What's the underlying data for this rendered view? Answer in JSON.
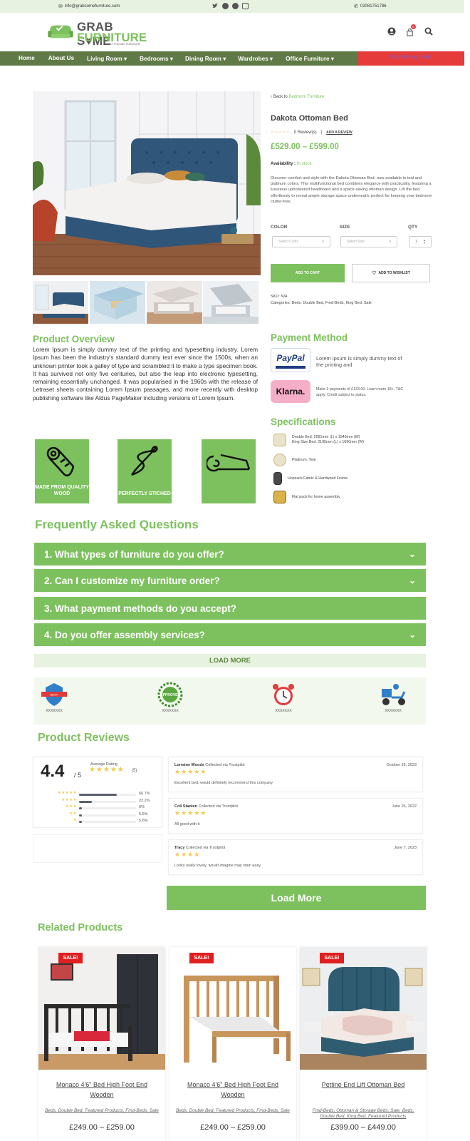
{
  "topbar": {
    "email": "info@grabsomefurniture.com",
    "phone": "02081751786"
  },
  "logo": {
    "line1": "GRAB S♥ME",
    "line2": "FURNITURE",
    "tag": "FAST HOUSING FURNITURE"
  },
  "nav": {
    "items": [
      "Home",
      "About Us",
      "Living Room ▾",
      "Bedrooms ▾",
      "Dining Room ▾",
      "Wardrobes ▾",
      "Office Furniture ▾"
    ],
    "deals": "Fast Moving Deals"
  },
  "cart": {
    "count": "0"
  },
  "product": {
    "back_prefix": "‹ Back to",
    "back_link": "Bedroom Furniture",
    "title": "Dakota Ottoman Bed",
    "review_stars": "☆☆☆☆☆",
    "reviews_count": "0 Review(s)",
    "add_review": "ADD A REVIEW",
    "price": "£529.00 – £599.00",
    "availability_label": "Availability :",
    "availability_value": "In stock",
    "description": "Discover comfort and style with the Dakota Ottoman Bed, now available in teal and platinum colors. This multifunctional bed combines elegance with practicality, featuring a luxurious upholstered headboard and a space-saving ottoman design. Lift the bed effortlessly to reveal ample storage space underneath, perfect for keeping your bedroom clutter-free.",
    "color_label": "COLOR",
    "color_placeholder": "Select Color",
    "size_label": "SIZE",
    "size_placeholder": "Select Size",
    "qty_label": "QTY",
    "qty_value": "1",
    "cart_button": "ADD TO CART",
    "wishlist_button": "ADD TO WISHLIST",
    "sku": "SKU: N/A",
    "categories": "Categories: Beds, Double Bed, Fmd-Beds, King Bed, Sale"
  },
  "overview": {
    "title": "Product Overview",
    "text": "Lorem Ipsum is simply dummy text of the printing and typesetting industry. Lorem Ipsum has been the industry's standard dummy text ever since the 1500s, when an unknown printer took a galley of type and scrambled it to make a type specimen book. It has survived not only five centuries, but also the leap into electronic typesetting, remaining essentially unchanged. It was popularised in the 1960s with the release of Letraset sheets containing Lorem Ipsum passages, and more recently with desktop publishing software like Aldus PageMaker including versions of Lorem Ipsum."
  },
  "features": [
    "MADE FROM QUALITY WOOD",
    "PERFECTLY STICHED",
    ""
  ],
  "payment": {
    "title": "Payment Method",
    "paypal_logo": "PayPal",
    "paypal_text": "Lorem Ipsum is simply dummy text of the printing and",
    "klarna_logo": "Klarna.",
    "klarna_text": "Make 3 payments of £133.00. Learn more 18+, T&C apply, Credit subject to status."
  },
  "specs": {
    "title": "Specifications",
    "items": [
      "Double Bed: 2091mm (L) x 1540mm (W)\nKing Size Bed: 2195mm (L) x 1690mm (W)",
      "Platinum, Teal",
      "Hopsack Fabric & Hardwood Frame",
      "Flat pack for home assembly"
    ]
  },
  "faq": {
    "title": "Frequently Asked Questions",
    "items": [
      "1. What types of furniture do you offer?",
      "2. Can I customize my furniture order?",
      "3. What payment methods do you accept?",
      "4. Do you offer assembly services?"
    ],
    "load_more": "LOAD MORE"
  },
  "badges": [
    "XXXXXXX",
    "XXXXXXX",
    "XXXXXXX",
    "XXXXXXX"
  ],
  "badge_texts": [
    "BEST",
    "APPROVED"
  ],
  "reviews": {
    "title": "Product Reviews",
    "rating": "4.4",
    "out_of": "/ 5",
    "avg_label": "Average Rating",
    "avg_stars": "★★★★★",
    "count": "(5)",
    "breakdown": [
      {
        "stars": "★★★★★",
        "pct": "66.7%",
        "fill": 0.667
      },
      {
        "stars": "★★★★",
        "pct": "22.2%",
        "fill": 0.222
      },
      {
        "stars": "★★★",
        "pct": "0%",
        "fill": 0.0
      },
      {
        "stars": "★★",
        "pct": "5.6%",
        "fill": 0.056
      },
      {
        "stars": "★",
        "pct": "5.6%",
        "fill": 0.056
      }
    ],
    "list": [
      {
        "name": "Lorraine Woods",
        "via": "Collected via Trustpilot",
        "date": "October 26, 2023",
        "stars": "★★★★★",
        "text": "Excellent bed, would definitely recommend this company"
      },
      {
        "name": "Coli Stanten",
        "via": "Collected via Trustpilot",
        "date": "June 26, 2022",
        "stars": "★★★★★",
        "text": "All good with it"
      },
      {
        "name": "Tracy",
        "via": "Collected via Trustpilot",
        "date": "June 7, 2023",
        "stars": "★★★★",
        "text": "Looks really lovely, would imagine may stain easy."
      }
    ],
    "load_more": "Load More"
  },
  "related": {
    "title": "Related Products",
    "sale_label": "SALE!",
    "items": [
      {
        "name": "Monaco 4'6\" Bed High Foot End Wooden",
        "cats": "Beds, Double Bed, Featured Products, Fmd-Beds, Sale",
        "price": "£249.00 – £259.00"
      },
      {
        "name": "Monaco 4'6\" Bed High Foot End Wooden",
        "cats": "Beds, Double Bed, Featured Products, Fmd-Beds, Sale",
        "price": "£249.00 – £259.00"
      },
      {
        "name": "Pettine End Lift Ottoman Bed",
        "cats": "Fmd-Beds, Ottoman & Storage Beds, Sale, Beds, Double Bed, King Bed, Featured Products",
        "price": "£399.00 – £449.00"
      }
    ]
  }
}
